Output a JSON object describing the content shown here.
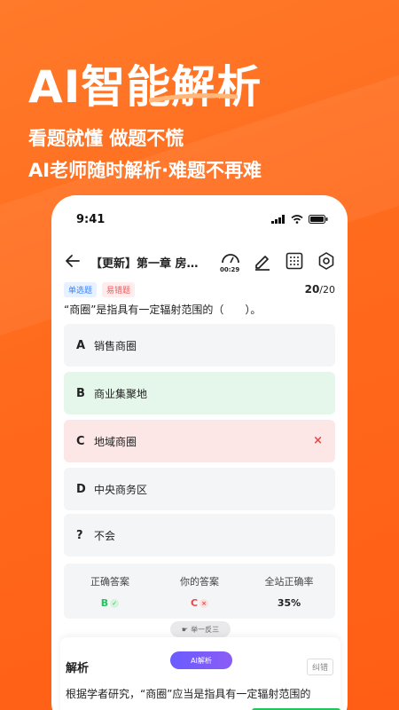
{
  "promo": {
    "headline": "AI智能解析",
    "tagline1": "看题就懂 做题不慌",
    "tagline2": "AI老师随时解析·难题不再难"
  },
  "status_bar": {
    "time": "9:41"
  },
  "nav": {
    "title": "【更新】第一章 房…",
    "timer": "00:29"
  },
  "question": {
    "tags": [
      "单选题",
      "易错题"
    ],
    "index": "20",
    "total": "/20",
    "text": "“商圈”是指具有一定辐射范围的（　　）。",
    "options": [
      {
        "letter": "A",
        "text": "销售商圈",
        "state": "normal"
      },
      {
        "letter": "B",
        "text": "商业集聚地",
        "state": "correct"
      },
      {
        "letter": "C",
        "text": "地域商圈",
        "state": "wrong",
        "mark": "×"
      },
      {
        "letter": "D",
        "text": "中央商务区",
        "state": "normal"
      },
      {
        "letter": "?",
        "text": "不会",
        "state": "normal"
      }
    ]
  },
  "stats": {
    "correct_label": "正确答案",
    "correct_value": "B",
    "yours_label": "你的答案",
    "yours_value": "C",
    "rate_label": "全站正确率",
    "rate_value": "35%"
  },
  "related_tab": "举一反三",
  "analysis": {
    "title": "解析",
    "ai_button": "AI解析",
    "report_button": "纠错",
    "text": "根据学者研究，“商圈”应当是指具有一定辐射范围的"
  },
  "colors": {
    "brand_orange": "#ff6a1c",
    "correct_green": "#22c55e",
    "wrong_red": "#ef4444",
    "ai_purple": "#7c5cff"
  }
}
